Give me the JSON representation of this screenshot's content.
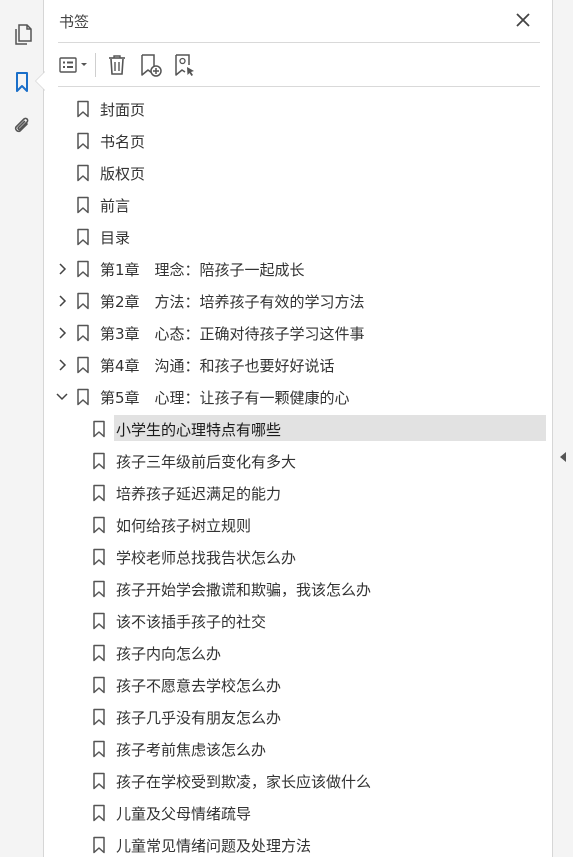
{
  "panel": {
    "title": "书签"
  },
  "icons": {
    "rail": [
      "pages-icon",
      "bookmark-icon",
      "attachment-icon"
    ],
    "toolbar": [
      "options-menu-icon",
      "delete-icon",
      "new-bookmark-icon",
      "bookmark-from-structure-icon"
    ],
    "accent": "#1a6fc9"
  },
  "bookmarks": [
    {
      "label": "封面页",
      "level": 1,
      "expander": "none"
    },
    {
      "label": "书名页",
      "level": 1,
      "expander": "none"
    },
    {
      "label": "版权页",
      "level": 1,
      "expander": "none"
    },
    {
      "label": "前言",
      "level": 1,
      "expander": "none"
    },
    {
      "label": "目录",
      "level": 1,
      "expander": "none"
    },
    {
      "label": "第1章　理念：陪孩子一起成长",
      "level": 1,
      "expander": "collapsed"
    },
    {
      "label": "第2章　方法：培养孩子有效的学习方法",
      "level": 1,
      "expander": "collapsed"
    },
    {
      "label": "第3章　心态：正确对待孩子学习这件事",
      "level": 1,
      "expander": "collapsed"
    },
    {
      "label": "第4章　沟通：和孩子也要好好说话",
      "level": 1,
      "expander": "collapsed"
    },
    {
      "label": "第5章　心理：让孩子有一颗健康的心",
      "level": 1,
      "expander": "expanded"
    },
    {
      "label": "小学生的心理特点有哪些",
      "level": 2,
      "selected": true
    },
    {
      "label": "孩子三年级前后变化有多大",
      "level": 2
    },
    {
      "label": "培养孩子延迟满足的能力",
      "level": 2
    },
    {
      "label": "如何给孩子树立规则",
      "level": 2
    },
    {
      "label": "学校老师总找我告状怎么办",
      "level": 2
    },
    {
      "label": "孩子开始学会撒谎和欺骗，我该怎么办",
      "level": 2
    },
    {
      "label": "该不该插手孩子的社交",
      "level": 2
    },
    {
      "label": "孩子内向怎么办",
      "level": 2
    },
    {
      "label": "孩子不愿意去学校怎么办",
      "level": 2
    },
    {
      "label": "孩子几乎没有朋友怎么办",
      "level": 2
    },
    {
      "label": "孩子考前焦虑该怎么办",
      "level": 2
    },
    {
      "label": "孩子在学校受到欺凌，家长应该做什么",
      "level": 2
    },
    {
      "label": "儿童及父母情绪疏导",
      "level": 2
    },
    {
      "label": "儿童常见情绪问题及处理方法",
      "level": 2
    }
  ]
}
